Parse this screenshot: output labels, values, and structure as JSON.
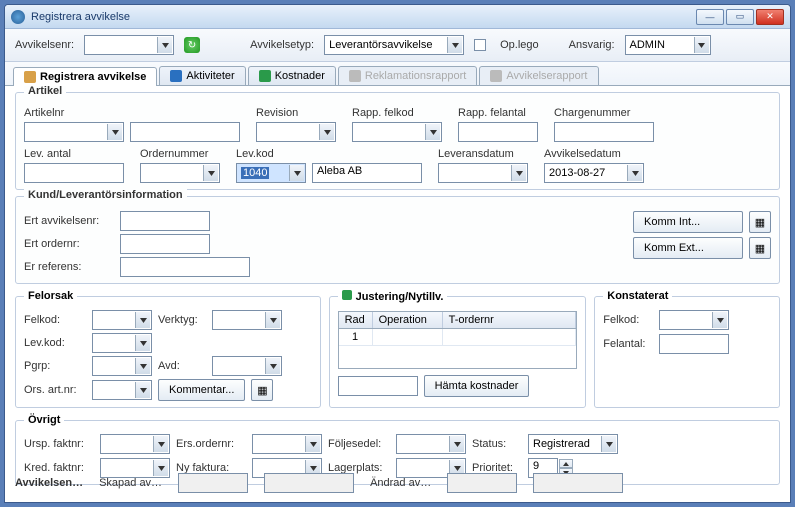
{
  "window": {
    "title": "Registrera avvikelse"
  },
  "toolbar": {
    "avvikelsenr_label": "Avvikelsenr:",
    "avvikelsenr_value": "",
    "avvikelsetyp_label": "Avvikelsetyp:",
    "avvikelsetyp_value": "Leverantörsavvikelse",
    "oplego_label": "Op.lego",
    "ansvarig_label": "Ansvarig:",
    "ansvarig_value": "ADMIN"
  },
  "tabs": {
    "registrera": "Registrera avvikelse",
    "aktiviteter": "Aktiviteter",
    "kostnader": "Kostnader",
    "reklam": "Reklamationsrapport",
    "avvrapport": "Avvikelserapport"
  },
  "artikel": {
    "group_title": "Artikel",
    "artikelnr_label": "Artikelnr",
    "artikelnr_value": "",
    "artikelnr_desc": "",
    "revision_label": "Revision",
    "revision_value": "",
    "rapp_felkod_label": "Rapp. felkod",
    "rapp_felkod_value": "",
    "rapp_felantal_label": "Rapp. felantal",
    "rapp_felantal_value": "",
    "chargenummer_label": "Chargenummer",
    "chargenummer_value": "",
    "lev_antal_label": "Lev. antal",
    "lev_antal_value": "",
    "ordernummer_label": "Ordernummer",
    "ordernummer_value": "",
    "levkod_label": "Lev.kod",
    "levkod_value": "1040",
    "levkod_name": "Aleba AB",
    "leveransdatum_label": "Leveransdatum",
    "leveransdatum_value": "",
    "avvikelsedatum_label": "Avvikelsedatum",
    "avvikelsedatum_value": "2013-08-27"
  },
  "kundlev": {
    "group_title": "Kund/Leverantörsinformation",
    "ert_avvikelsenr_label": "Ert avvikelsenr:",
    "ert_avvikelsenr_value": "",
    "ert_ordernr_label": "Ert ordernr:",
    "ert_ordernr_value": "",
    "er_referens_label": "Er referens:",
    "er_referens_value": "",
    "komm_int_btn": "Komm Int...",
    "komm_ext_btn": "Komm Ext..."
  },
  "felorsak": {
    "group_title": "Felorsak",
    "felkod_label": "Felkod:",
    "felkod_value": "",
    "verktyg_label": "Verktyg:",
    "verktyg_value": "",
    "levkod_label": "Lev.kod:",
    "levkod_value": "",
    "pgrp_label": "Pgrp:",
    "pgrp_value": "",
    "avd_label": "Avd:",
    "avd_value": "",
    "ors_artnr_label": "Ors. art.nr:",
    "ors_artnr_value": "",
    "kommentar_btn": "Kommentar..."
  },
  "justering": {
    "group_title": "Justering/Nytillv.",
    "col_rad": "Rad",
    "col_operation": "Operation",
    "col_tordernr": "T-ordernr",
    "row1_rad": "1",
    "row1_operation": "",
    "row1_tordernr": "",
    "sum_value": "",
    "hamta_btn": "Hämta kostnader"
  },
  "konstaterat": {
    "group_title": "Konstaterat",
    "felkod_label": "Felkod:",
    "felkod_value": "",
    "felantal_label": "Felantal:",
    "felantal_value": ""
  },
  "ovrigt": {
    "group_title": "Övrigt",
    "ursp_faktnr_label": "Ursp. faktnr:",
    "ursp_faktnr_value": "",
    "ers_ordernr_label": "Ers.ordernr:",
    "ers_ordernr_value": "",
    "foljesedel_label": "Följesedel:",
    "foljesedel_value": "",
    "status_label": "Status:",
    "status_value": "Registrerad",
    "kred_faktnr_label": "Kred. faktnr:",
    "kred_faktnr_value": "",
    "ny_faktura_label": "Ny faktura:",
    "ny_faktura_value": "",
    "lagerplats_label": "Lagerplats:",
    "lagerplats_value": "",
    "prioritet_label": "Prioritet:",
    "prioritet_value": "9"
  },
  "footer": {
    "avvikelsen_label": "Avvikelsen…",
    "skapad_av_label": "Skapad av…",
    "skapad_av_value": "",
    "skapad_av_date": "",
    "andrad_av_label": "Ändrad av…",
    "andrad_av_value": "",
    "andrad_av_date": ""
  }
}
